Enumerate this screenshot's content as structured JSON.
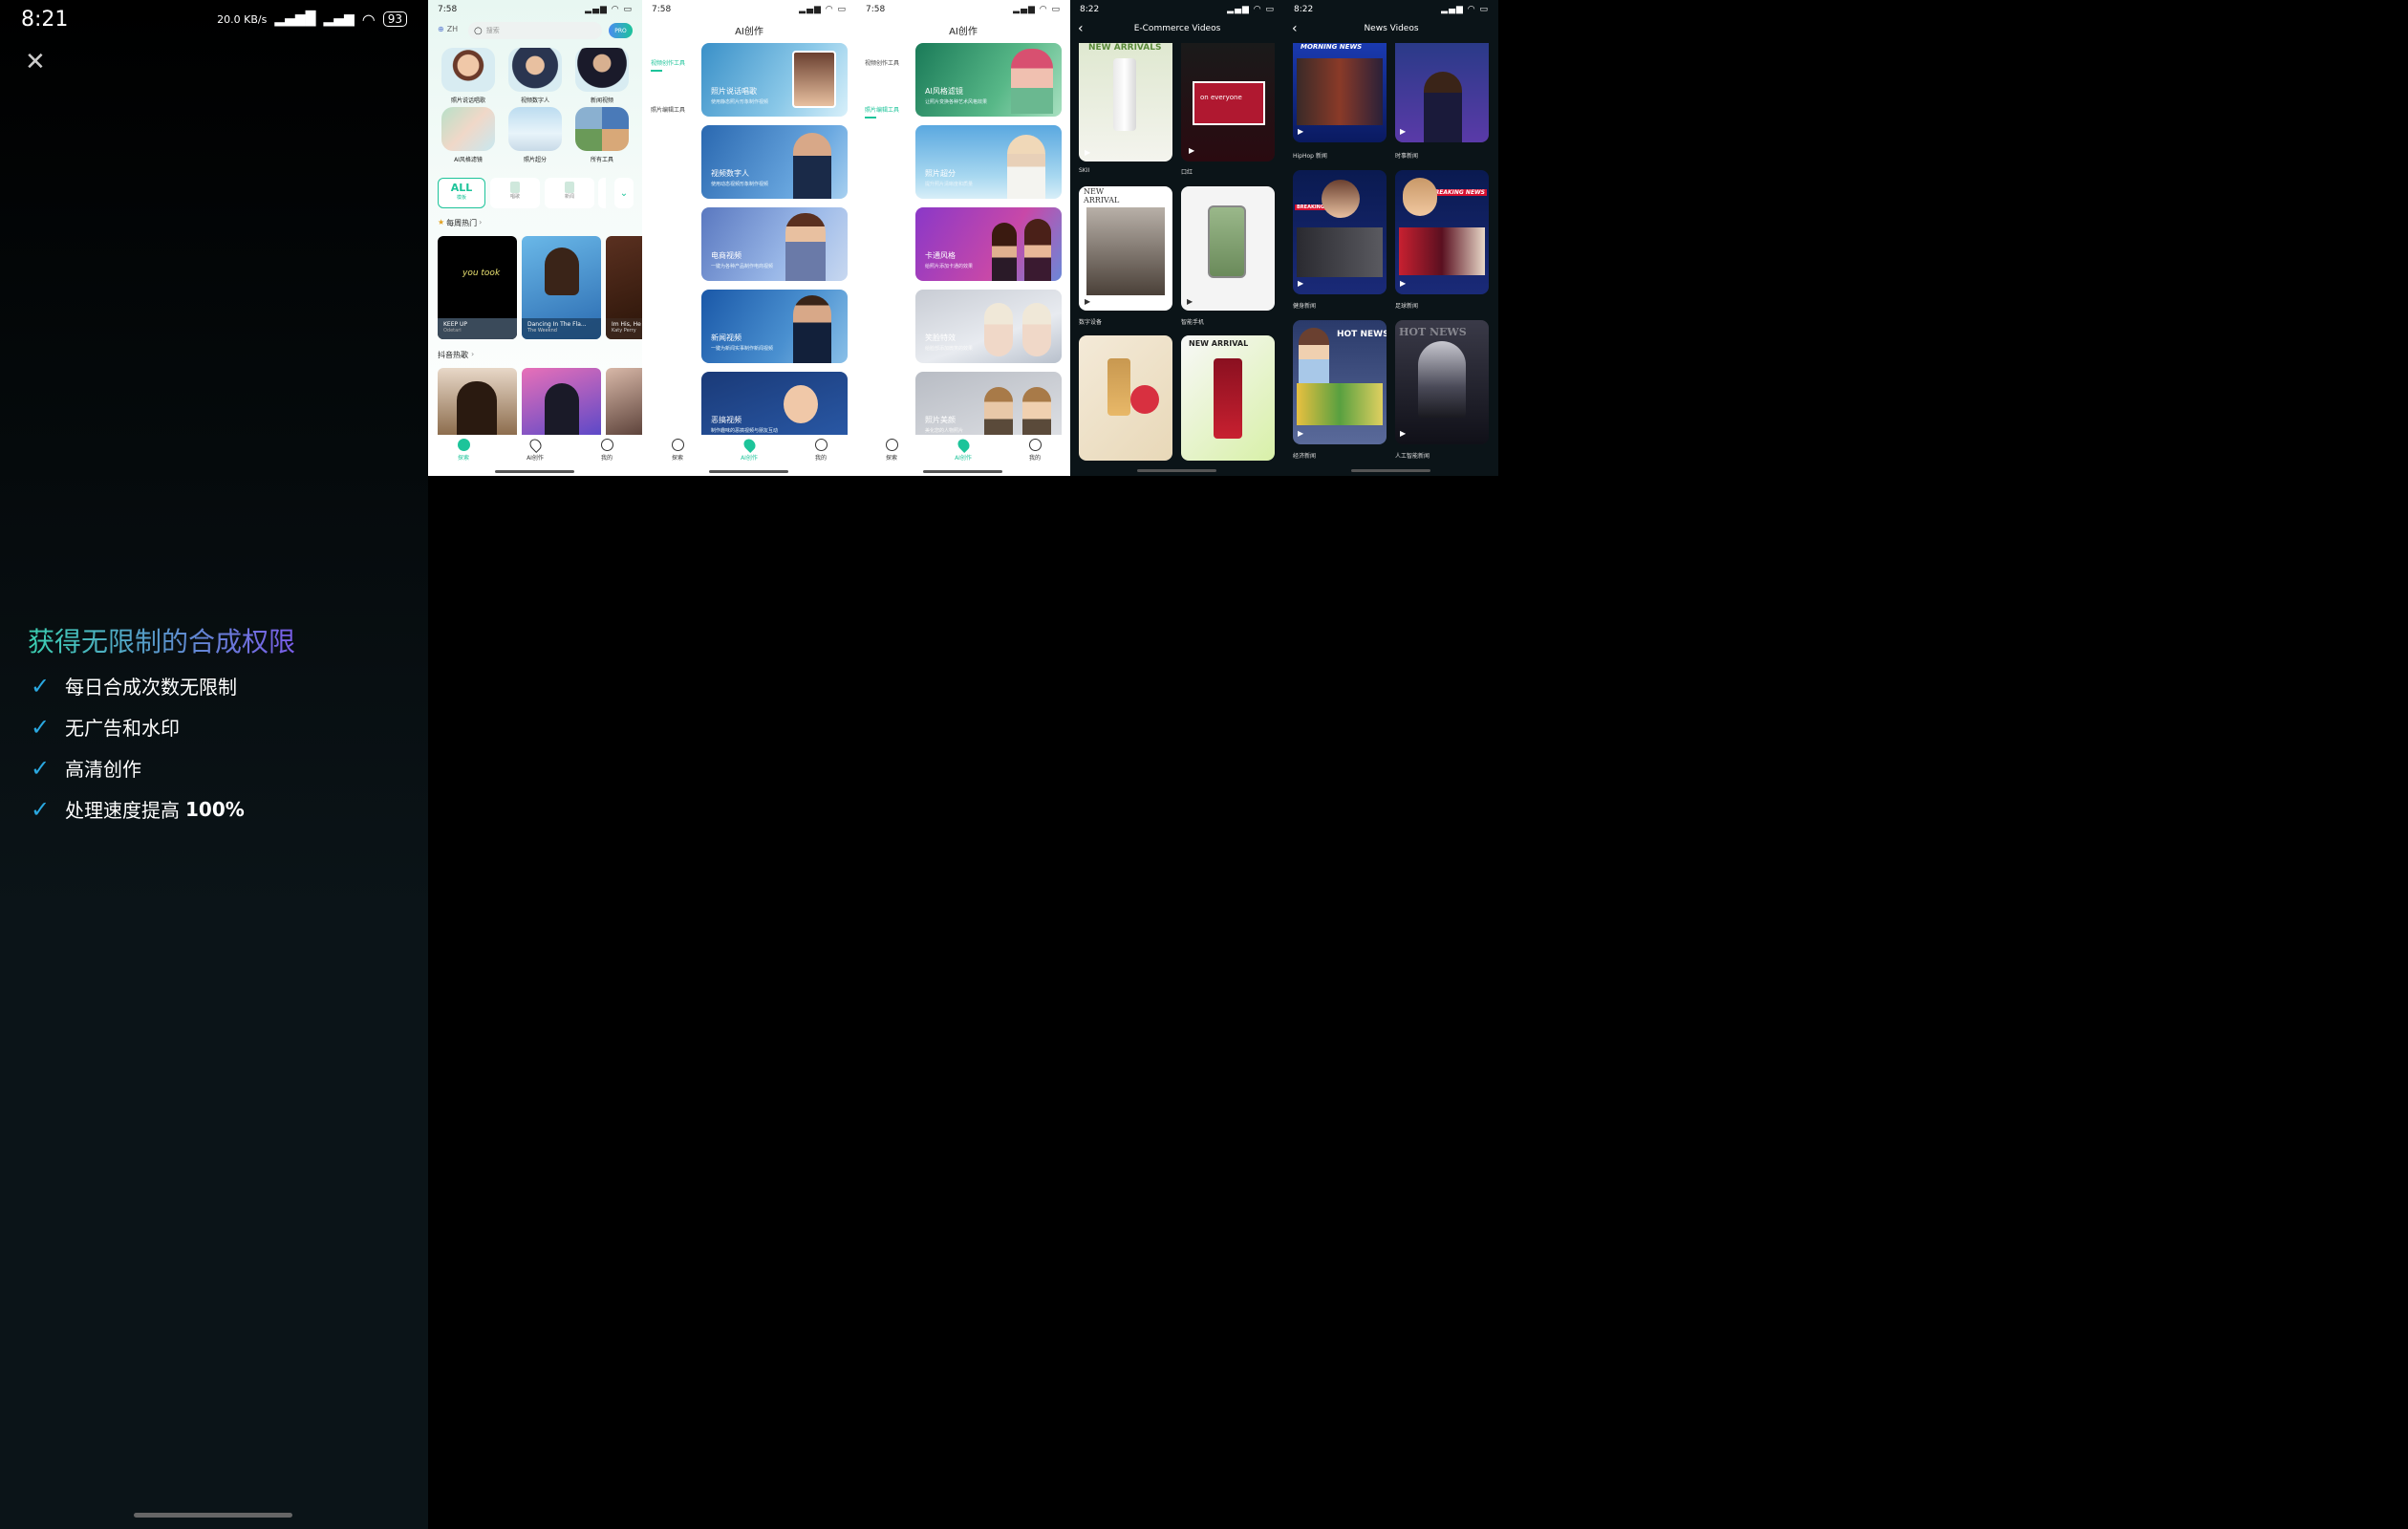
{
  "colors": {
    "accent": "#1dc49a",
    "panel_dark": "#0b1418",
    "title_gradient": "#3ad0b0"
  },
  "screen1": {
    "time": "8:21",
    "net_speed": "20.0 KB/s",
    "battery": "93",
    "close_icon": "close-icon",
    "title": "获得无限制的合成权限",
    "features": [
      {
        "text": "每日合成次数无限制"
      },
      {
        "text": "无广告和水印"
      },
      {
        "text": "高清创作"
      },
      {
        "text": "处理速度提高",
        "bold": "100%"
      }
    ]
  },
  "screen2": {
    "time": "7:58",
    "lang": "ZH",
    "search_placeholder": "搜索",
    "pro": "PRO",
    "tools": [
      "照片说话唱歌",
      "视频数字人",
      "新闻视频",
      "AI风格滤镜",
      "照片超分",
      "所有工具"
    ],
    "filters": [
      {
        "big": "ALL",
        "small": "模板"
      },
      {
        "small": "唱歌"
      },
      {
        "small": "新闻"
      }
    ],
    "section1": "每周热门",
    "hot": [
      {
        "title": "KEEP UP",
        "artist": "Odetari",
        "overlay": "you took"
      },
      {
        "title": "Dancing In The Fla...",
        "artist": "The Weeknd"
      },
      {
        "title": "Im His, He",
        "artist": "Katy Perry"
      }
    ],
    "section2": "抖音热歌",
    "nav": [
      "探索",
      "AI创作",
      "我的"
    ]
  },
  "screen3": {
    "time": "7:58",
    "title": "AI创作",
    "side": [
      "视频创作工具",
      "照片编辑工具"
    ],
    "cards": [
      {
        "title": "照片说话唱歌",
        "sub": "使用静态照片形象制作视频"
      },
      {
        "title": "视频数字人",
        "sub": "使用动态视频形象制作视频"
      },
      {
        "title": "电商视频",
        "sub": "一键为各种产品制作电商视频"
      },
      {
        "title": "新闻视频",
        "sub": "一键为新闻实事制作新闻视频"
      },
      {
        "title": "恶搞视频",
        "sub": "制作趣味的恶搞视频与朋友互动"
      }
    ],
    "nav": [
      "探索",
      "AI创作",
      "我的"
    ]
  },
  "screen4": {
    "time": "7:58",
    "title": "AI创作",
    "side": [
      "视频创作工具",
      "照片编辑工具"
    ],
    "cards": [
      {
        "title": "AI风格滤镜",
        "sub": "让照片变换各种艺术风格效果"
      },
      {
        "title": "照片超分",
        "sub": "提升照片清晰度和质量"
      },
      {
        "title": "卡通风格",
        "sub": "给照片添加卡通的效果"
      },
      {
        "title": "笑脸特效",
        "sub": "给脸部添加微笑的效果"
      },
      {
        "title": "照片美颜",
        "sub": "美化您的人物照片"
      }
    ],
    "nav": [
      "探索",
      "AI创作",
      "我的"
    ]
  },
  "screen5": {
    "time": "8:22",
    "title": "E-Commerce Videos",
    "items": [
      {
        "label": "SKII",
        "overlay": "NEW ARRIVALS"
      },
      {
        "label": "口红",
        "overlay": "on everyone"
      },
      {
        "label": "数字设备",
        "overlay": "NEW ARRIVAL"
      },
      {
        "label": "智能手机",
        "overlay": ""
      },
      {
        "label": "",
        "overlay": ""
      },
      {
        "label": "",
        "overlay": "NEW ARRIVAL"
      }
    ]
  },
  "screen6": {
    "time": "8:22",
    "title": "News Videos",
    "items": [
      {
        "label": "HipHop 新闻",
        "overlay": "MORNING NEWS"
      },
      {
        "label": "时事新闻",
        "overlay": ""
      },
      {
        "label": "健身新闻",
        "overlay": "BREAKING NEWS"
      },
      {
        "label": "足球新闻",
        "overlay": "BREAKING NEWS"
      },
      {
        "label": "经济新闻",
        "overlay": "HOT NEWS"
      },
      {
        "label": "人工智能新闻",
        "overlay": "HOT NEWS"
      }
    ]
  }
}
